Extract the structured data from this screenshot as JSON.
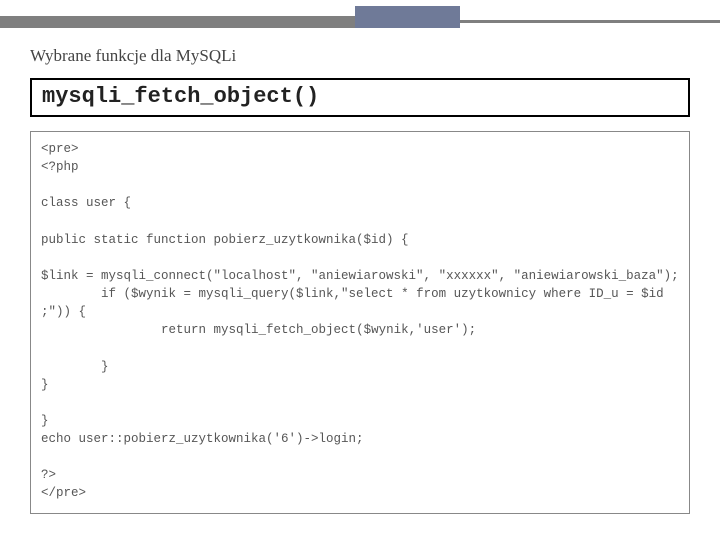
{
  "header": {
    "subtitle": "Wybrane funkcje dla MySQLi",
    "function_name": "mysqli_fetch_object()"
  },
  "code": {
    "body": "<pre>\n<?php\n\nclass user {\n\npublic static function pobierz_uzytkownika($id) {\n\n$link = mysqli_connect(\"localhost\", \"aniewiarowski\", \"xxxxxx\", \"aniewiarowski_baza\");\n        if ($wynik = mysqli_query($link,\"select * from uzytkownicy where ID_u = $id ;\")) {\n                return mysqli_fetch_object($wynik,'user');\n\n        }\n}\n\n}\necho user::pobierz_uzytkownika('6')->login;\n\n?>\n</pre>"
  }
}
